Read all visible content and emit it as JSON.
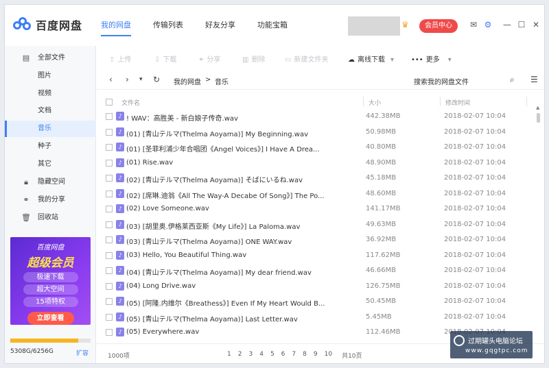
{
  "app": {
    "name": "百度网盘"
  },
  "nav": {
    "items": [
      "我的网盘",
      "传输列表",
      "好友分享",
      "功能宝箱"
    ]
  },
  "header": {
    "vip_label": "会员中心"
  },
  "sidebar": {
    "items": [
      {
        "label": "全部文件",
        "icon": "file-icon"
      },
      {
        "label": "图片",
        "icon": ""
      },
      {
        "label": "视频",
        "icon": ""
      },
      {
        "label": "文档",
        "icon": ""
      },
      {
        "label": "音乐",
        "icon": ""
      },
      {
        "label": "种子",
        "icon": ""
      },
      {
        "label": "其它",
        "icon": ""
      },
      {
        "label": "隐藏空间",
        "icon": "lock-icon"
      },
      {
        "label": "我的分享",
        "icon": "share-icon"
      },
      {
        "label": "回收站",
        "icon": "trash-icon"
      }
    ],
    "promo": {
      "brand": "百度网盘",
      "headline": "超级会员",
      "pills": [
        "极速下载",
        "超大空间",
        "15项特权"
      ],
      "cta": "立即查看"
    },
    "storage": {
      "text": "5308G/6256G",
      "used_gb": 5308,
      "total_gb": 6256,
      "expand_label": "扩容"
    }
  },
  "toolbar": {
    "upload": "上传",
    "download": "下载",
    "share": "分享",
    "delete": "删除",
    "new_folder": "新建文件夹",
    "offline": "离线下载",
    "more": "更多"
  },
  "pathbar": {
    "crumbs": [
      "我的网盘",
      "音乐"
    ],
    "separator": ">",
    "search_label": "搜索我的网盘文件"
  },
  "table": {
    "headers": {
      "name": "文件名",
      "size": "大小",
      "modified": "修改时间"
    },
    "rows": [
      {
        "name": "! WAV：高胜美 - 新白娘子传奇.wav",
        "size": "442.38MB",
        "date": "2018-02-07 10:04"
      },
      {
        "name": "(01) [青山テルマ(Thelma Aoyama)] My Beginning.wav",
        "size": "50.98MB",
        "date": "2018-02-07 10:04"
      },
      {
        "name": "(01) [圣菲利浦少年合唱团《Angel Voices》] I Have A Drea...",
        "size": "40.80MB",
        "date": "2018-02-07 10:04"
      },
      {
        "name": "(01) Rise.wav",
        "size": "48.90MB",
        "date": "2018-02-07 10:04"
      },
      {
        "name": "(02) [青山テルマ(Thelma Aoyama)] そばにいるね.wav",
        "size": "45.18MB",
        "date": "2018-02-07 10:04"
      },
      {
        "name": "(02) [席琳.迪翁《All The Way-A Decabe Of Song》] The Po...",
        "size": "48.60MB",
        "date": "2018-02-07 10:04"
      },
      {
        "name": "(02) Love Someone.wav",
        "size": "141.17MB",
        "date": "2018-02-07 10:04"
      },
      {
        "name": "(03) [胡里奥.伊格莱西亚斯《My Life》] La Paloma.wav",
        "size": "49.63MB",
        "date": "2018-02-07 10:04"
      },
      {
        "name": "(03) [青山テルマ(Thelma Aoyama)] ONE WAY.wav",
        "size": "36.92MB",
        "date": "2018-02-07 10:04"
      },
      {
        "name": "(03) Hello, You Beautiful Thing.wav",
        "size": "117.62MB",
        "date": "2018-02-07 10:04"
      },
      {
        "name": "(04) [青山テルマ(Thelma Aoyama)] My dear friend.wav",
        "size": "46.66MB",
        "date": "2018-02-07 10:04"
      },
      {
        "name": "(04) Long Drive.wav",
        "size": "126.75MB",
        "date": "2018-02-07 10:04"
      },
      {
        "name": "(05) [阿隆.内维尔《Breathess》] Even If My Heart Would B...",
        "size": "50.45MB",
        "date": "2018-02-07 10:04"
      },
      {
        "name": "(05) [青山テルマ(Thelma Aoyama)] Last Letter.wav",
        "size": "5.45MB",
        "date": "2018-02-07 10:04"
      },
      {
        "name": "(05) Everywhere.wav",
        "size": "112.46MB",
        "date": "2018-02-07 10:04"
      }
    ]
  },
  "footer": {
    "count": "1000项",
    "pages": [
      "1",
      "2",
      "3",
      "4",
      "5",
      "6",
      "7",
      "8",
      "9",
      "10"
    ],
    "total_pages": "共10页"
  },
  "watermark": {
    "line1": "过期罐头电脑论坛",
    "line2": "www.gqgtpc.com"
  },
  "colors": {
    "accent": "#3d7ff5",
    "vip": "#ef4a4a",
    "storage": "#f5b622",
    "music_icon": "#8a82e8"
  }
}
